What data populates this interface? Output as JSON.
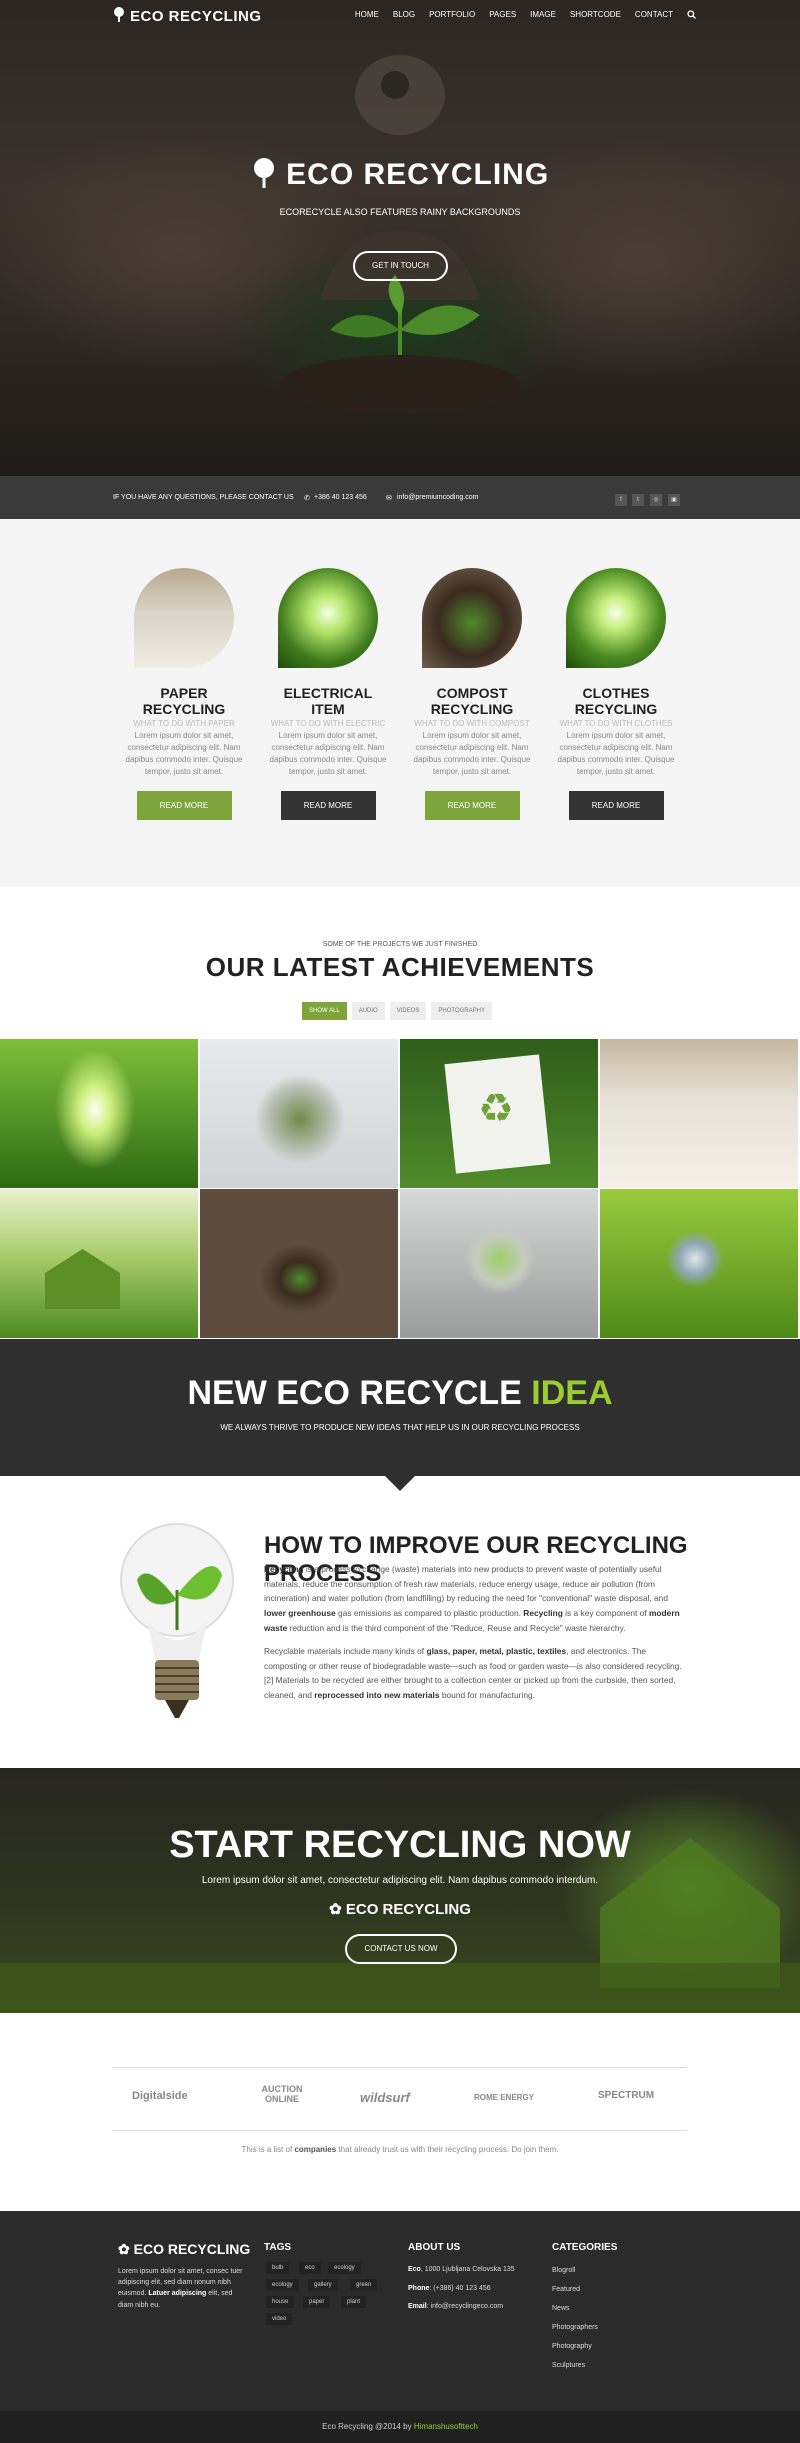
{
  "header": {
    "logo": "ECO RECYCLING",
    "menu": [
      "HOME",
      "BLOG",
      "PORTFOLIO",
      "PAGES",
      "IMAGE",
      "SHORTCODE",
      "CONTACT"
    ]
  },
  "hero": {
    "title": "ECO RECYCLING",
    "subtitle": "ECORECYCLE ALSO FEATURES RAINY BACKGROUNDS",
    "button": "GET IN TOUCH"
  },
  "contact_bar": {
    "text": "IF YOU HAVE ANY QUESTIONS, PLEASE CONTACT US",
    "phone": "+386 40 123 456",
    "email": "info@premiumcoding.com"
  },
  "services": [
    {
      "title": "PAPER RECYCLING",
      "subtitle": "WHAT TO DO WITH PAPER",
      "text": "Lorem ipsum dolor sit amet, consectetur adipiscing elit. Nam dapibus commodo inter. Quisque tempor, justo sit amet.",
      "button": "READ MORE",
      "button_color": "#7ea53b"
    },
    {
      "title": "ELECTRICAL ITEM",
      "subtitle": "WHAT TO DO WITH ELECTRIC",
      "text": "Lorem ipsum dolor sit amet, consectetur adipiscing elit. Nam dapibus commodo inter. Quisque tempor, justo sit amet.",
      "button": "READ MORE",
      "button_color": "#333333"
    },
    {
      "title": "COMPOST RECYCLING",
      "subtitle": "WHAT TO DO WITH COMPOST",
      "text": "Lorem ipsum dolor sit amet, consectetur adipiscing elit. Nam dapibus commodo inter. Quisque tempor, justo sit amet.",
      "button": "READ MORE",
      "button_color": "#7ea53b"
    },
    {
      "title": "CLOTHES RECYCLING",
      "subtitle": "WHAT TO DO WITH CLOTHES",
      "text": "Lorem ipsum dolor sit amet, consectetur adipiscing elit. Nam dapibus commodo inter. Quisque tempor, justo sit amet.",
      "button": "READ MORE",
      "button_color": "#333333"
    }
  ],
  "achievements": {
    "small": "SOME OF THE PROJECTS WE JUST FINISHED",
    "title": "OUR LATEST ACHIEVEMENTS",
    "filters": [
      "SHOW ALL",
      "AUDIO",
      "VIDEOS",
      "PHOTOGRAPHY"
    ]
  },
  "idea": {
    "title_a": "NEW ECO RECYCLE ",
    "title_b": "IDEA",
    "subtitle": "WE ALWAYS THRIVE TO PRODUCE NEW IDEAS THAT HELP US IN OUR RECYCLING PROCESS"
  },
  "process": {
    "title": "HOW TO IMPROVE OUR RECYCLING PROCESS",
    "p1": [
      {
        "b": "Recycling"
      },
      {
        "t": " is a process to change (waste) materials into new products to prevent waste of potentially useful materials, reduce the consumption of fresh raw materials, reduce energy usage, reduce air pollution (from incineration) and water pollution (from landfilling) by reducing the need for \"conventional\" waste disposal, and "
      },
      {
        "b": "lower greenhouse"
      },
      {
        "t": " gas emissions as compared to plastic production. "
      },
      {
        "b": "Recycling"
      },
      {
        "t": " is a key component of "
      },
      {
        "b": "modern waste"
      },
      {
        "t": " reduction and is the third component of the \"Reduce, Reuse and Recycle\" waste hierarchy."
      }
    ],
    "p2": [
      {
        "t": "Recyclable materials include many kinds of "
      },
      {
        "b": "glass, paper, metal, plastic, textiles"
      },
      {
        "t": ", and electronics. The composting or other reuse of biodegradable waste—such as food or garden waste—is also considered recycling.[2] Materials to be recycled are either brought to a collection center or picked up from the curbside, then sorted, cleaned, and "
      },
      {
        "b": "reprocessed into new materials"
      },
      {
        "t": " bound for manufacturing."
      }
    ]
  },
  "start": {
    "title": "START RECYCLING NOW",
    "subtitle": "Lorem ipsum dolor sit amet, consectetur adipiscing elit. Nam dapibus commodo interdum.",
    "logo": "ECO RECYCLING",
    "button": "CONTACT US NOW"
  },
  "clients": {
    "logos": [
      "Digitalside",
      "AUCTION ONLINE",
      "wildsurf",
      "ROME ENERGY",
      "SPECTRUM"
    ],
    "note_a": "This is a list of ",
    "note_b": "companies",
    "note_c": " that already trust us with their recycling process. Do join them."
  },
  "footer": {
    "logo": "ECO RECYCLING",
    "about_a": "Lorem ipsum dolor sit amet, consec tuer adipiscing elit, sed diam nonum nibh euismod. ",
    "about_b": "Latuer adipiscing",
    "about_c": " elit, sed diam nibh eu.",
    "tags_title": "TAGS",
    "tags": [
      "bulb",
      "eco",
      "ecology",
      "ecology",
      "gallery",
      "green",
      "house",
      "paper",
      "plant",
      "video"
    ],
    "about_title": "ABOUT US",
    "eco_label": "Eco",
    "eco_value": ", 1000 Ljubljana Celovska 135",
    "phone_label": "Phone",
    "phone_value": ": (+386) 40 123 456",
    "email_label": "Email",
    "email_value": ": info@recyclingeco.com",
    "categories_title": "CATEGORIES",
    "categories": [
      "Blogroll",
      "Featured",
      "News",
      "Photographers",
      "Photography",
      "Sculptures"
    ],
    "copyright_a": "Eco Recycling @2014 by ",
    "copyright_b": "Himanshusofttech"
  },
  "colors": {
    "accent": "#7ea53b",
    "dark": "#2f2f2f"
  }
}
